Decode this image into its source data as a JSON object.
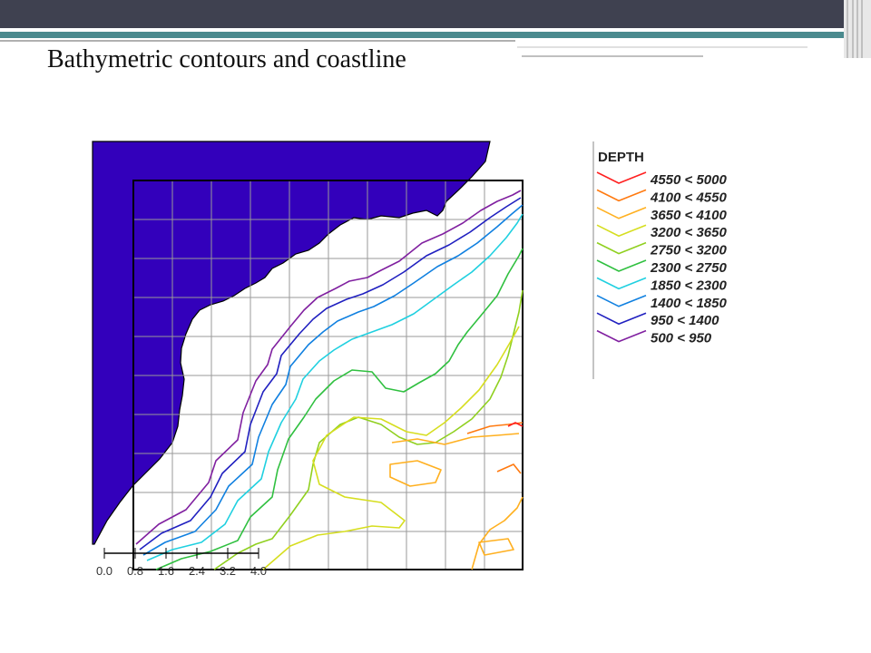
{
  "slide": {
    "title": "Bathymetric contours and coastline"
  },
  "theme": {
    "header_bar": "#3f4150",
    "accent_stripe": "#4b8a8e",
    "land": "#3300bb",
    "coast_outline": "#000000",
    "grid": "#9a9a9a"
  },
  "map": {
    "legend": {
      "title": "DEPTH",
      "entries": [
        {
          "label": "4550 < 5000",
          "color": "#ff2020"
        },
        {
          "label": "4100 < 4550",
          "color": "#ff7a10"
        },
        {
          "label": "3650 < 4100",
          "color": "#ffb020"
        },
        {
          "label": "3200 < 3650",
          "color": "#d6de20"
        },
        {
          "label": "2750 < 3200",
          "color": "#90d020"
        },
        {
          "label": "2300 < 2750",
          "color": "#30c040"
        },
        {
          "label": "1850 < 2300",
          "color": "#20d0e0"
        },
        {
          "label": "1400 < 1850",
          "color": "#1080e0"
        },
        {
          "label": "950 < 1400",
          "color": "#2020c0"
        },
        {
          "label": "500 < 950",
          "color": "#8020a0"
        }
      ]
    },
    "scale_bar": {
      "ticks": [
        "0.0",
        "0.8",
        "1.6",
        "2.4",
        "3.2",
        "4.0"
      ]
    }
  }
}
